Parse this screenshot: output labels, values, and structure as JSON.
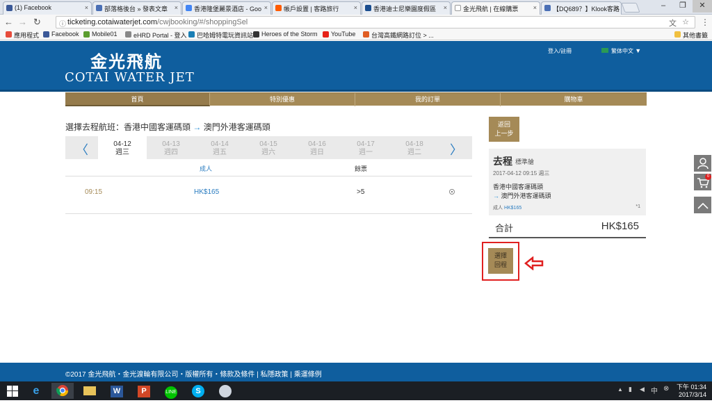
{
  "browser": {
    "tabs": [
      {
        "title": "(1) Facebook",
        "color": "#3b5998"
      },
      {
        "title": "部落格後台 » 發表文章",
        "color": "#4a6fb5"
      },
      {
        "title": "香港隆堡麗景酒店 - Goo",
        "color": "#4285f4"
      },
      {
        "title": "帳戶設置 | 客路旅行",
        "color": "#ff5b00"
      },
      {
        "title": "香港迪士尼樂園度假區",
        "color": "#1a4d8f"
      },
      {
        "title": "金光飛航 | 在線購票",
        "color": "#888888"
      },
      {
        "title": "【DQ689？】Klook客路",
        "color": "#4a6fb5"
      }
    ],
    "url_host": "ticketing.cotaiwaterjet.com",
    "url_path": "/cwjbooking/#/shoppingSel",
    "bookmarks": [
      {
        "label": "應用程式",
        "color": "#e74c3c"
      },
      {
        "label": "Facebook",
        "color": "#3b5998"
      },
      {
        "label": "Mobile01",
        "color": "#5a9c2e"
      },
      {
        "label": "eHRD Portal - 登入",
        "color": "#888888"
      },
      {
        "label": "巴哈姆特電玩資訊站",
        "color": "#1a7fb5"
      },
      {
        "label": "Heroes of the Storm",
        "color": "#333333"
      },
      {
        "label": "YouTube",
        "color": "#e62117"
      },
      {
        "label": "台灣高鐵網路訂位 > ...",
        "color": "#e05d22"
      }
    ],
    "other_bookmarks": "其他書籤"
  },
  "site": {
    "logo_cn": "金光飛航",
    "logo_en": "COTAI WATER JET",
    "login": "登入/註冊",
    "language": "繁体中文",
    "nav": [
      "首頁",
      "特別優惠",
      "我的訂單",
      "購物車"
    ]
  },
  "trip": {
    "title_prefix": "選擇去程航班：香港中國客運碼頭",
    "arrow": "→",
    "destination": "澳門外港客運碼頭",
    "dates": [
      {
        "date": "04-12",
        "day": "週三"
      },
      {
        "date": "04-13",
        "day": "週四"
      },
      {
        "date": "04-14",
        "day": "週五"
      },
      {
        "date": "04-15",
        "day": "週六"
      },
      {
        "date": "04-16",
        "day": "週日"
      },
      {
        "date": "04-17",
        "day": "週一"
      },
      {
        "date": "04-18",
        "day": "週二"
      }
    ],
    "col_adult": "成人",
    "col_remaining": "餘票",
    "row": {
      "time": "09:15",
      "price": "HK$165",
      "remaining": ">5"
    }
  },
  "panel": {
    "back_line1": "返回",
    "back_line2": "上一步",
    "outbound": "去程",
    "class": "標準艙",
    "datetime": "2017-04-12 09:15 週三",
    "from": "香港中國客運碼頭",
    "to": "澳門外港客運碼頭",
    "pax_label": "成人",
    "pax_price": "HK$165",
    "pax_qty": "*1",
    "total_label": "合計",
    "total_value": "HK$165",
    "return_line1": "選擇",
    "return_line2": "回程"
  },
  "cart_badge": "0",
  "footer": "©2017 金光飛航・金光渡輪有限公司・版權所有・條款及條件 | 私隱政策 | 乘運條例",
  "taskbar": {
    "time": "下午 01:34",
    "date": "2017/3/14"
  },
  "colors": {
    "brand_blue": "#0f5e9e",
    "gold": "#a58a57",
    "highlight_red": "#e02020"
  }
}
